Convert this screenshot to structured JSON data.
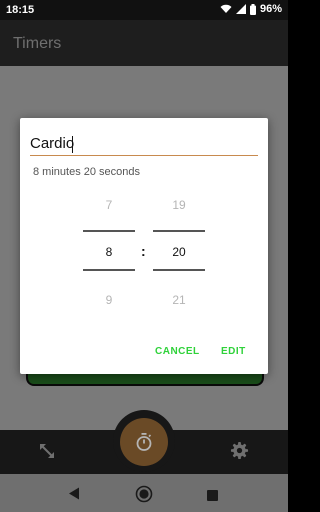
{
  "status_bar": {
    "time": "18:15",
    "battery_percent": "96%",
    "icons": [
      "wifi-icon",
      "signal-icon",
      "battery-icon"
    ]
  },
  "app_bar": {
    "title": "Timers"
  },
  "dialog": {
    "name_value": "Cardio",
    "duration_text": "8 minutes 20 seconds",
    "minutes_picker": {
      "previous": "7",
      "current": "8",
      "next": "9"
    },
    "separator": ":",
    "seconds_picker": {
      "previous": "19",
      "current": "20",
      "next": "21"
    },
    "cancel_label": "CANCEL",
    "edit_label": "EDIT"
  },
  "bottom_bar": {
    "left_icon": "resize-arrows-icon",
    "fab_icon": "stopwatch-icon",
    "right_icon": "gear-icon"
  },
  "system_nav": {
    "icons": [
      "back-icon",
      "home-icon",
      "recents-icon"
    ]
  },
  "colors": {
    "accent": "#2fd23a",
    "input_underline": "#c88a4e",
    "fab": "#6a4a26",
    "timer_card": "#1a4d1a"
  }
}
